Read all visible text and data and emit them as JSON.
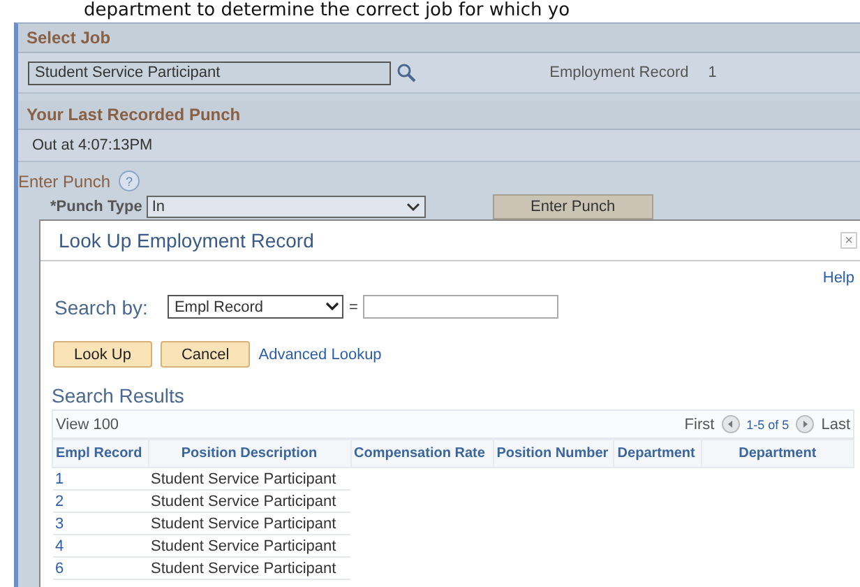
{
  "caption": "department to determine the correct job for which yo",
  "select_job": {
    "title": "Select Job",
    "job_value": "Student Service Participant",
    "record_label": "Employment Record",
    "record_value": "1"
  },
  "last_punch": {
    "title": "Your Last Recorded Punch",
    "text": "Out at  4:07:13PM"
  },
  "enter_punch": {
    "title": "Enter Punch",
    "help": "?",
    "punch_type_label": "*Punch Type",
    "punch_type_value": "In",
    "button": "Enter Punch"
  },
  "dialog": {
    "title": "Look Up Employment Record",
    "close": "×",
    "help_link": "Help",
    "search_label": "Search by:",
    "search_field_value": "Empl Record",
    "equals": "=",
    "buttons": [
      "Look Up",
      "Cancel"
    ],
    "advanced_link": "Advanced Lookup",
    "results_title": "Search Results",
    "view": "View 100",
    "first": "First",
    "range": "1-5 of 5",
    "last": "Last",
    "columns": [
      "Empl Record",
      "Position Description",
      "Compensation Rate",
      "Position Number",
      "Department",
      "Department"
    ],
    "rows": [
      {
        "record": "1",
        "description": "Student Service Participant"
      },
      {
        "record": "2",
        "description": "Student Service Participant"
      },
      {
        "record": "3",
        "description": "Student Service Participant"
      },
      {
        "record": "4",
        "description": "Student Service Participant"
      },
      {
        "record": "6",
        "description": "Student Service Participant"
      }
    ]
  }
}
